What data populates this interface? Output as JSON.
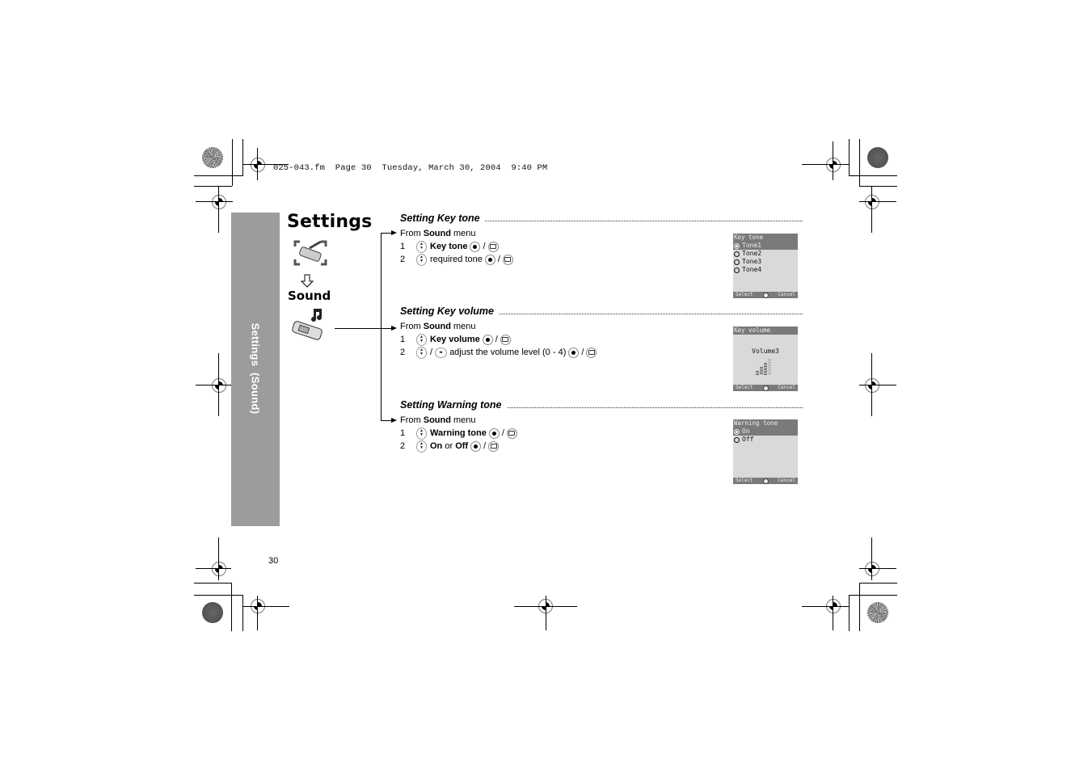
{
  "header": {
    "file_line": "025-043.fm  Page 30  Tuesday, March 30, 2004  9:40 PM"
  },
  "sidebar": {
    "label": "Settings  (Sound)"
  },
  "page": {
    "title": "Settings",
    "submenu_title": "Sound",
    "page_number": "30",
    "icons": [
      "settings-phone-icon",
      "down-arrow-icon",
      "music-note-icon",
      "phone-sound-icon"
    ]
  },
  "sections": [
    {
      "title": "Setting Key tone",
      "from_prefix": "From ",
      "from_bold": "Sound",
      "from_suffix": " menu",
      "steps": [
        {
          "num": "1",
          "bold": "Key tone",
          "text": "",
          "extra": ""
        },
        {
          "num": "2",
          "bold": "",
          "text": "required tone",
          "extra": ""
        }
      ],
      "screen": {
        "header": "Key tone",
        "items": [
          {
            "label": "Tone1",
            "selected": true
          },
          {
            "label": "Tone2",
            "selected": false
          },
          {
            "label": "Tone3",
            "selected": false
          },
          {
            "label": "Tone4",
            "selected": false
          }
        ],
        "left_soft": "Select",
        "right_soft": "Cancel"
      }
    },
    {
      "title": "Setting Key volume",
      "from_prefix": "From ",
      "from_bold": "Sound",
      "from_suffix": " menu",
      "steps": [
        {
          "num": "1",
          "bold": "Key volume",
          "text": ""
        },
        {
          "num": "2",
          "bold": "",
          "text": "adjust the volume level (0 - 4)"
        }
      ],
      "screen": {
        "header": "Key volume",
        "value_label": "Volume3",
        "level": 3,
        "max_level": 4,
        "left_soft": "Select",
        "right_soft": "Cancel"
      }
    },
    {
      "title": "Setting Warning tone",
      "from_prefix": "From ",
      "from_bold": "Sound",
      "from_suffix": " menu",
      "steps": [
        {
          "num": "1",
          "bold": "Warning tone"
        },
        {
          "num": "2",
          "bold": "On",
          "mid": " or ",
          "bold2": "Off"
        }
      ],
      "screen": {
        "header": "Warning tone",
        "items": [
          {
            "label": "On",
            "selected": true
          },
          {
            "label": "Off",
            "selected": false
          }
        ],
        "left_soft": "Select",
        "right_soft": "Cancel"
      }
    }
  ],
  "glyphs": {
    "slash": "/",
    "nav_up": "▲",
    "nav_down": "▼",
    "lr": "◂▸"
  }
}
